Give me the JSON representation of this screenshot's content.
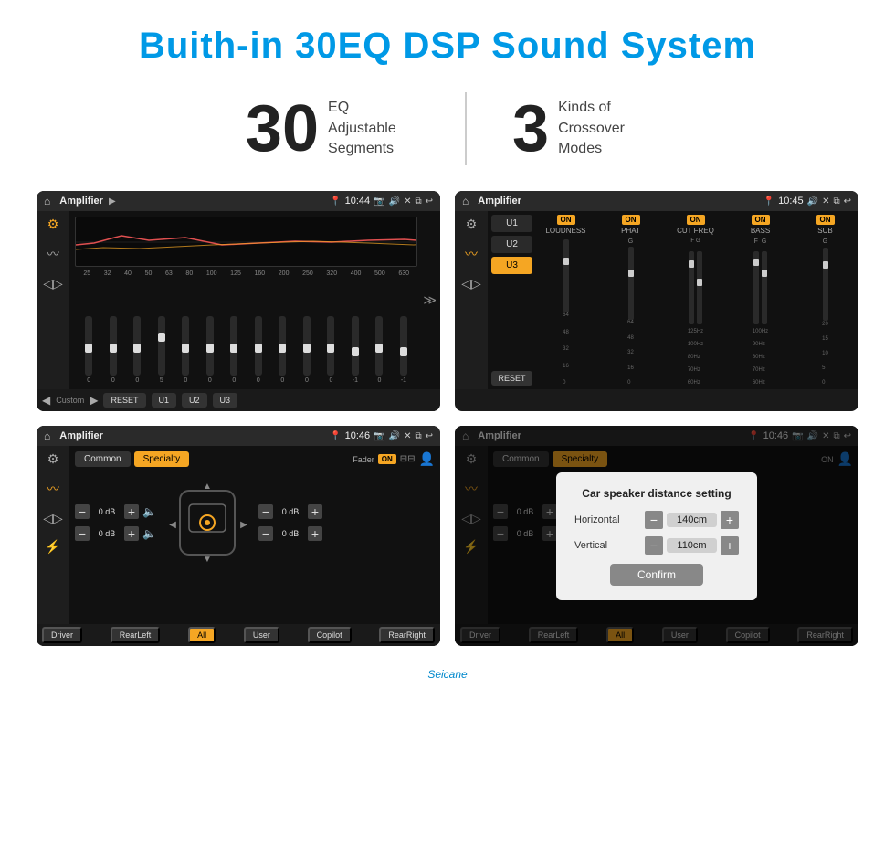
{
  "title": "Buith-in 30EQ DSP Sound System",
  "stats": [
    {
      "number": "30",
      "text": "EQ Adjustable\nSegments"
    },
    {
      "number": "3",
      "text": "Kinds of\nCrossover Modes"
    }
  ],
  "screens": [
    {
      "id": "eq-screen",
      "statusbar": {
        "title": "Amplifier",
        "time": "10:44"
      },
      "type": "eq",
      "freqs": [
        "25",
        "32",
        "40",
        "50",
        "63",
        "80",
        "100",
        "125",
        "160",
        "200",
        "250",
        "320",
        "400",
        "500",
        "630"
      ],
      "values": [
        "0",
        "0",
        "0",
        "5",
        "0",
        "0",
        "0",
        "0",
        "0",
        "0",
        "0",
        "-1",
        "0",
        "-1"
      ],
      "buttons": [
        "Custom",
        "RESET",
        "U1",
        "U2",
        "U3"
      ]
    },
    {
      "id": "crossover-screen",
      "statusbar": {
        "title": "Amplifier",
        "time": "10:45"
      },
      "type": "crossover",
      "channels": [
        "LOUDNESS",
        "PHAT",
        "CUT FREQ",
        "BASS",
        "SUB"
      ],
      "uButtons": [
        "U1",
        "U2",
        "U3"
      ],
      "activeU": "U3"
    },
    {
      "id": "specialty-screen",
      "statusbar": {
        "title": "Amplifier",
        "time": "10:46"
      },
      "type": "specialty",
      "tabs": [
        "Common",
        "Specialty"
      ],
      "activeTab": "Specialty",
      "faderLabel": "Fader",
      "faderOn": "ON",
      "dbValues": [
        "0 dB",
        "0 dB",
        "0 dB",
        "0 dB"
      ],
      "bottomButtons": [
        "Driver",
        "RearLeft",
        "All",
        "User",
        "Copilot",
        "RearRight"
      ]
    },
    {
      "id": "dialog-screen",
      "statusbar": {
        "title": "Amplifier",
        "time": "10:46"
      },
      "type": "dialog",
      "tabs": [
        "Common",
        "Specialty"
      ],
      "activeTab": "Specialty",
      "dialog": {
        "title": "Car speaker distance setting",
        "horizontal": {
          "label": "Horizontal",
          "value": "140cm"
        },
        "vertical": {
          "label": "Vertical",
          "value": "110cm"
        },
        "confirmLabel": "Confirm"
      },
      "dbValues": [
        "0 dB",
        "0 dB"
      ],
      "bottomButtons": [
        "Driver",
        "RearLeft",
        "All",
        "User",
        "Copilot",
        "RearRight"
      ]
    }
  ],
  "watermark": "Seicane"
}
